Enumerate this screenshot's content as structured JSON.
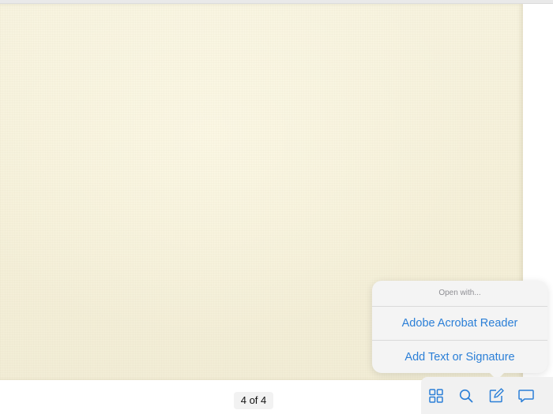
{
  "viewer": {
    "page_indicator": "4 of 4"
  },
  "open_with_menu": {
    "header": "Open with...",
    "items": [
      {
        "label": "Adobe Acrobat Reader"
      },
      {
        "label": "Add Text or Signature"
      }
    ]
  },
  "toolbar": {
    "buttons": [
      {
        "icon": "grid-icon"
      },
      {
        "icon": "search-icon"
      },
      {
        "icon": "markup-icon"
      },
      {
        "icon": "comment-icon"
      }
    ]
  },
  "colors": {
    "accent": "#2b7fd7",
    "paper": "#f5f0d9"
  }
}
